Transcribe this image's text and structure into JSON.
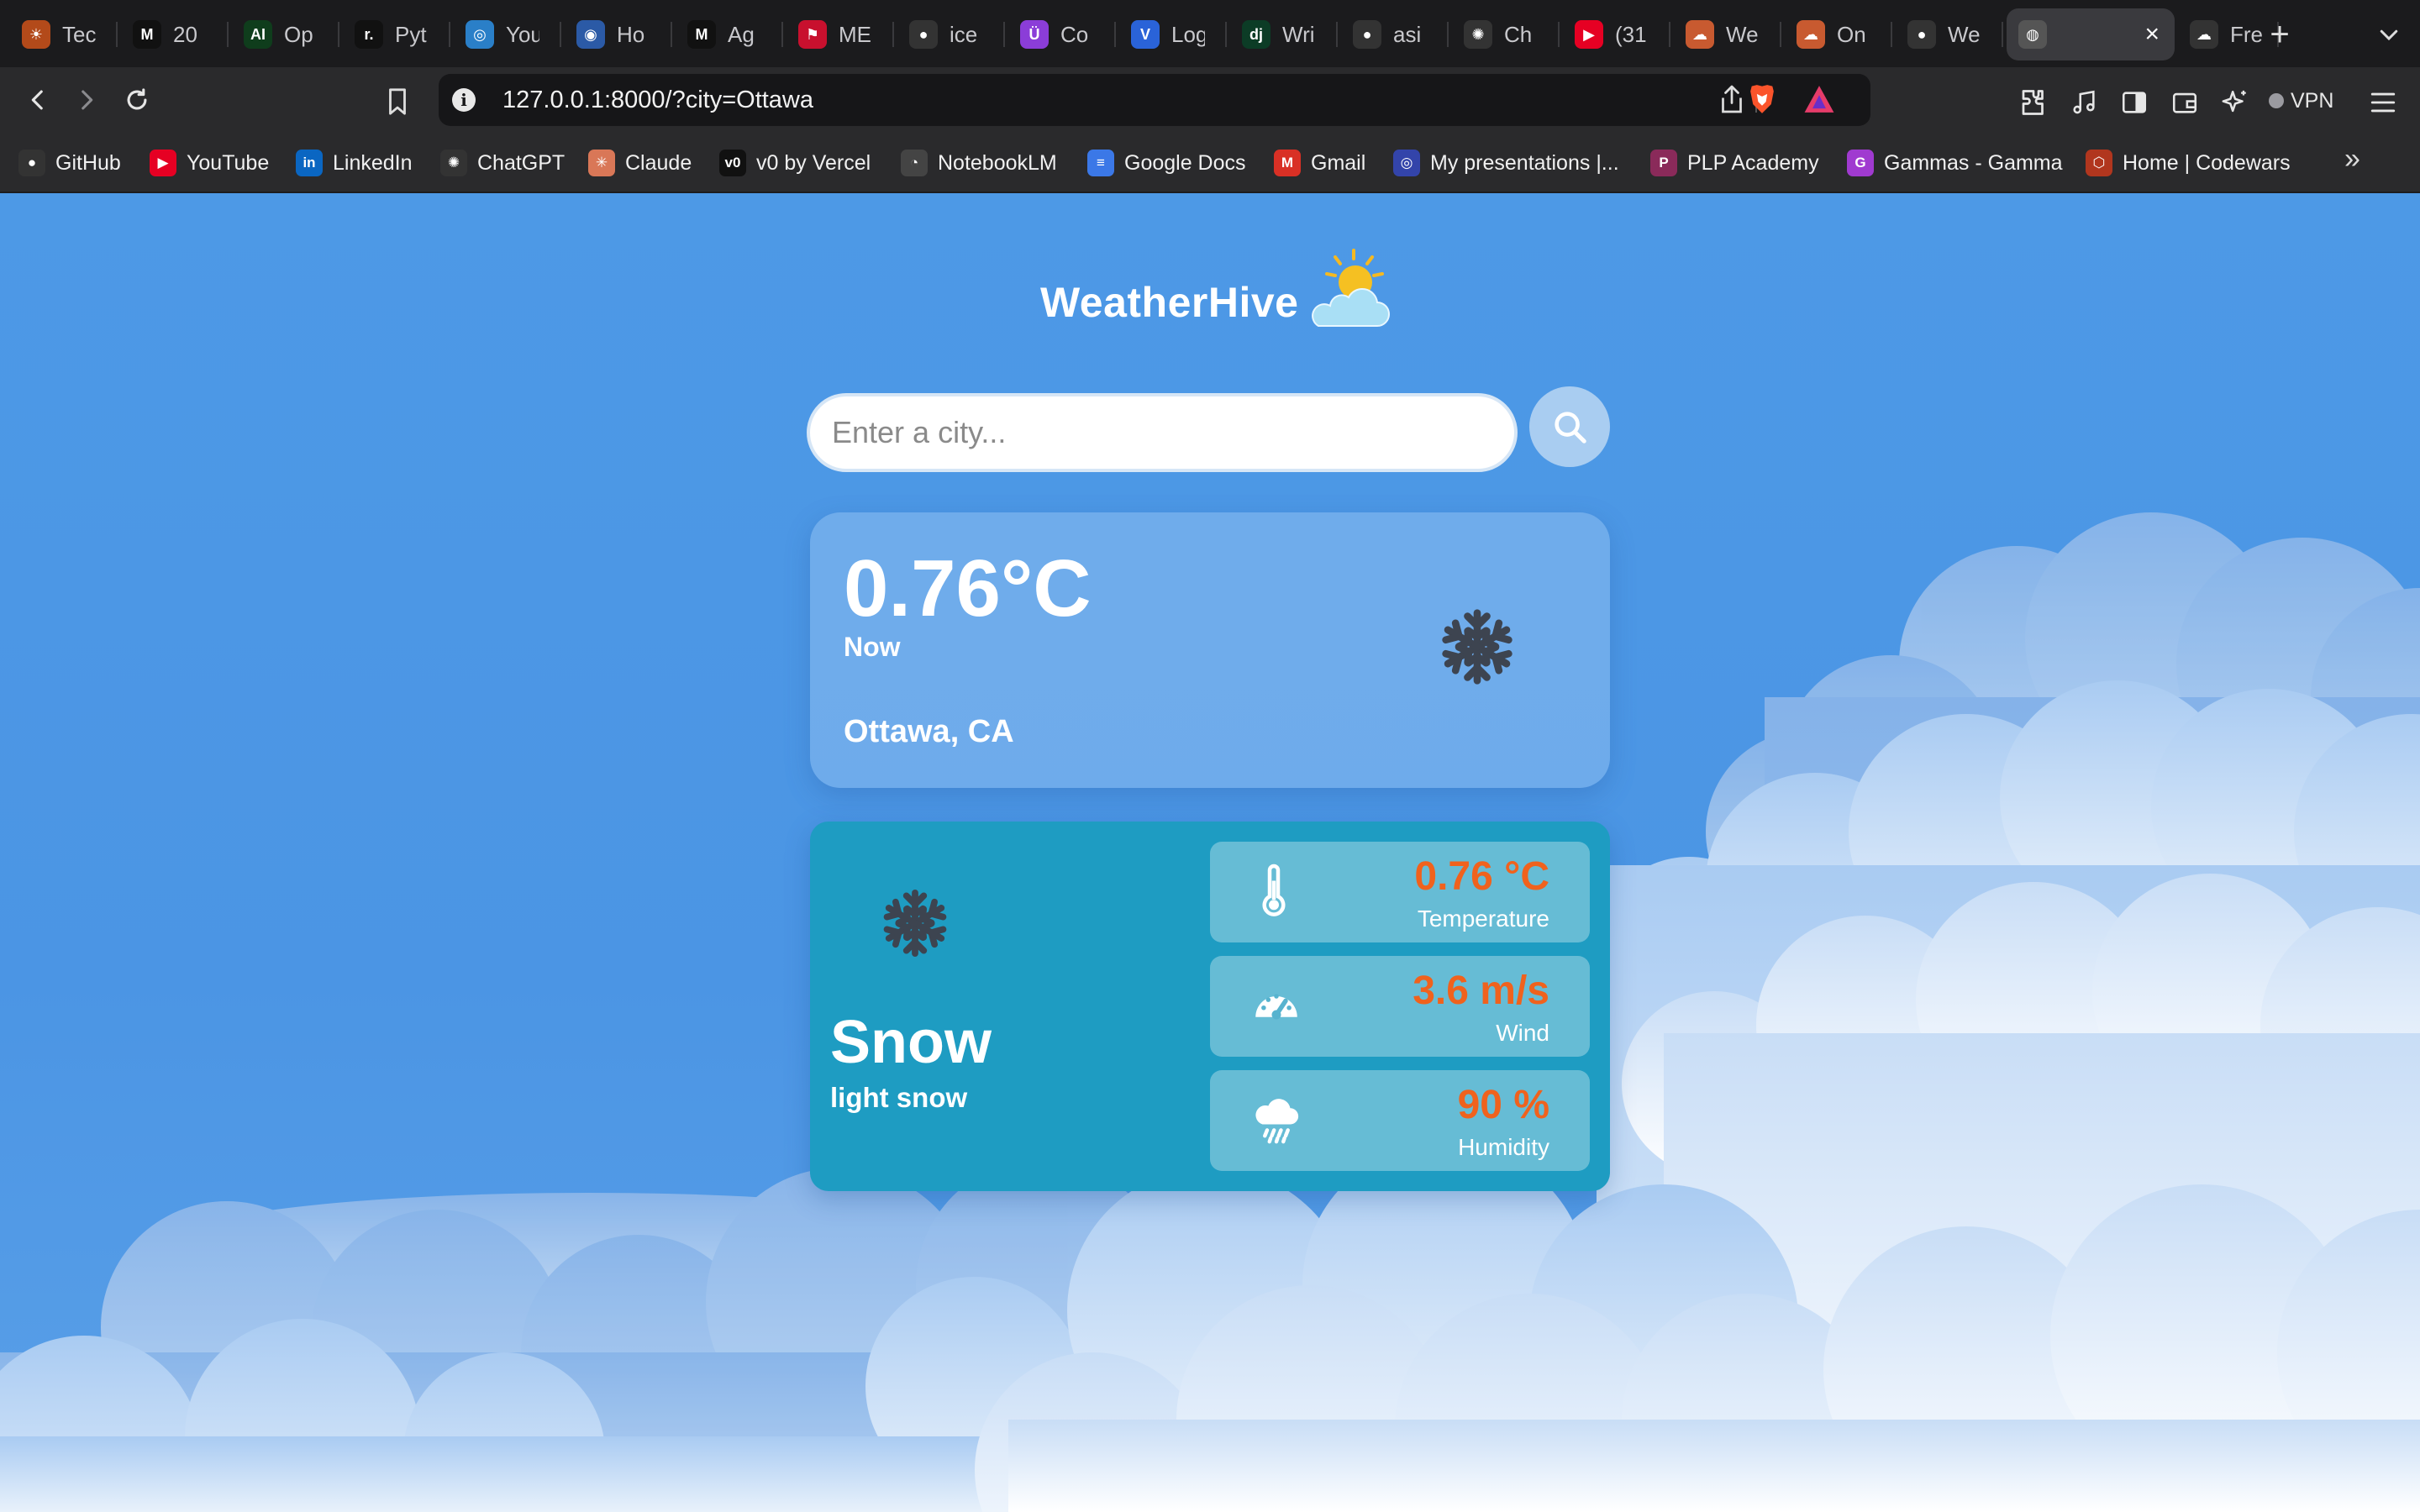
{
  "browser": {
    "tabs": [
      {
        "title": "Tec",
        "fav": "☀",
        "fav_color": "#b34a1a"
      },
      {
        "title": "20",
        "fav": "M",
        "fav_color": "#111111"
      },
      {
        "title": "Op",
        "fav": "AI",
        "fav_color": "#0f3d1c"
      },
      {
        "title": "Pyt",
        "fav": "r.",
        "fav_color": "#111111"
      },
      {
        "title": "You",
        "fav": "◎",
        "fav_color": "#2a7fc8"
      },
      {
        "title": "Ho",
        "fav": "◉",
        "fav_color": "#2b5aa6"
      },
      {
        "title": "Ag",
        "fav": "M",
        "fav_color": "#111111"
      },
      {
        "title": "ME",
        "fav": "⚑",
        "fav_color": "#c8102e"
      },
      {
        "title": "ice",
        "fav": "●",
        "fav_color": "#333333"
      },
      {
        "title": "Co",
        "fav": "Ü",
        "fav_color": "#8b3dd8"
      },
      {
        "title": "Log",
        "fav": "V",
        "fav_color": "#2a63d8"
      },
      {
        "title": "Wri",
        "fav": "dj",
        "fav_color": "#0c3c26"
      },
      {
        "title": "asi",
        "fav": "●",
        "fav_color": "#333333"
      },
      {
        "title": "Ch",
        "fav": "✺",
        "fav_color": "#333333"
      },
      {
        "title": "(31",
        "fav": "▶",
        "fav_color": "#e60023"
      },
      {
        "title": "We",
        "fav": "☁",
        "fav_color": "#c85a30"
      },
      {
        "title": "On",
        "fav": "☁",
        "fav_color": "#c85a30"
      },
      {
        "title": "We",
        "fav": "●",
        "fav_color": "#333333"
      },
      {
        "title": "",
        "fav": "◍",
        "fav_color": "#555555",
        "active": true
      },
      {
        "title": "Fre",
        "fav": "☁",
        "fav_color": "#333333"
      }
    ],
    "url": "127.0.0.1:8000/?city=Ottawa",
    "vpn_label": "VPN",
    "bookmarks": [
      {
        "label": "GitHub",
        "fav": "●",
        "fav_color": "#333333"
      },
      {
        "label": "YouTube",
        "fav": "▶",
        "fav_color": "#e60023"
      },
      {
        "label": "LinkedIn",
        "fav": "in",
        "fav_color": "#0a66c2"
      },
      {
        "label": "ChatGPT",
        "fav": "✺",
        "fav_color": "#333333"
      },
      {
        "label": "Claude",
        "fav": "✳",
        "fav_color": "#d97757"
      },
      {
        "label": "v0 by Vercel",
        "fav": "v0",
        "fav_color": "#111111"
      },
      {
        "label": "NotebookLM",
        "fav": "◔",
        "fav_color": "#444444"
      },
      {
        "label": "Google Docs",
        "fav": "≡",
        "fav_color": "#3b78e7"
      },
      {
        "label": "Gmail",
        "fav": "M",
        "fav_color": "#d93025"
      },
      {
        "label": "My presentations |...",
        "fav": "◎",
        "fav_color": "#3344aa"
      },
      {
        "label": "PLP Academy",
        "fav": "P",
        "fav_color": "#8a2a5a"
      },
      {
        "label": "Gammas - Gamma",
        "fav": "G",
        "fav_color": "#a03ad0"
      },
      {
        "label": "Home | Codewars",
        "fav": "⬡",
        "fav_color": "#b1361e"
      }
    ]
  },
  "app": {
    "brand_name": "WeatherHive",
    "search": {
      "placeholder": "Enter a city...",
      "value": ""
    },
    "now": {
      "temperature": "0.76°C",
      "label": "Now",
      "city": "Ottawa, CA",
      "icon": "snowflake-icon"
    },
    "details": {
      "condition": "Snow",
      "description": "light snow",
      "icon": "snowflake-icon",
      "metrics": [
        {
          "value": "0.76 °C",
          "label": "Temperature",
          "icon": "thermometer-icon"
        },
        {
          "value": "3.6 m/s",
          "label": "Wind",
          "icon": "gauge-icon"
        },
        {
          "value": "90 %",
          "label": "Humidity",
          "icon": "rain-cloud-icon"
        }
      ]
    },
    "colors": {
      "background": "#4b95e4",
      "accent_value": "#f0621d",
      "detail_card": "#1e9cc2"
    }
  }
}
